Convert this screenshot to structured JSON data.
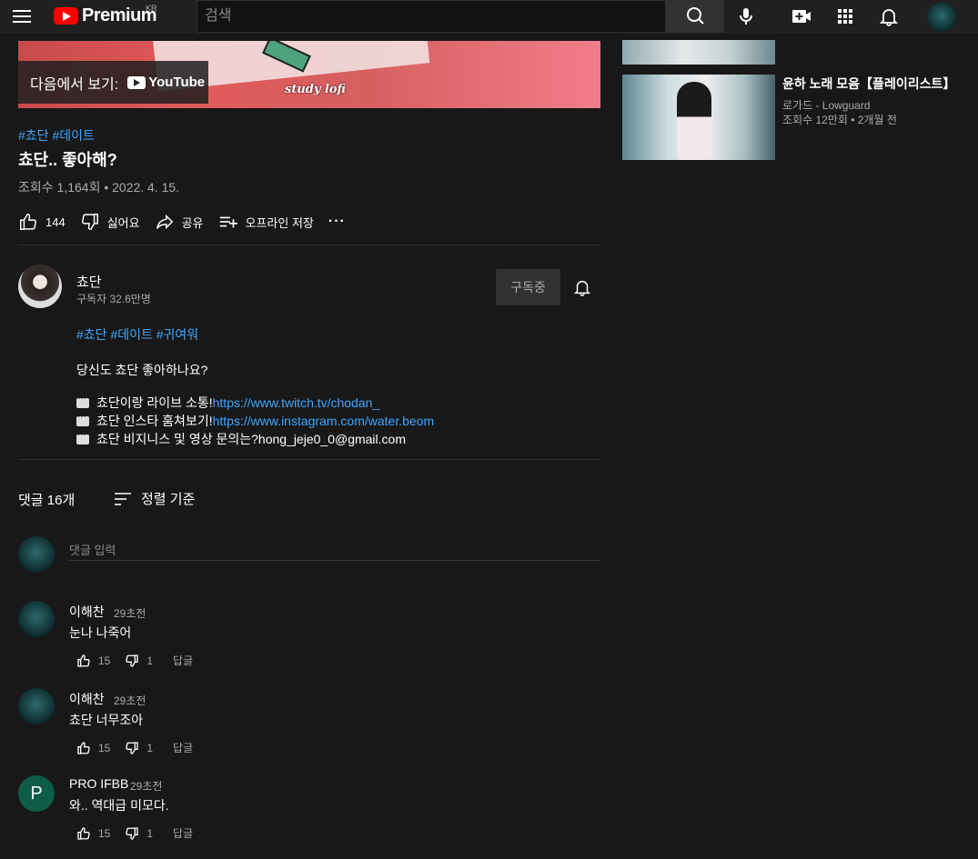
{
  "header": {
    "logo_text": "Premium",
    "region": "KR",
    "search_placeholder": "검색"
  },
  "player": {
    "watch_on_label": "다음에서 보기:",
    "watch_on_brand": "YouTube",
    "overlay_text": "study lofi"
  },
  "video": {
    "hashtags": [
      "#쵸단",
      "#데이트"
    ],
    "title": "쵸단.. 좋아해?",
    "meta": "조회수 1,164회 • 2022. 4. 15.",
    "like_count": "144",
    "dislike_label": "싫어요",
    "share_label": "공유",
    "save_label": "오프라인 저장",
    "more_label": "···"
  },
  "channel": {
    "name": "쵸단",
    "subscribers": "구독자 32.6만명",
    "subscribe_label": "구독중"
  },
  "description": {
    "hashtags": [
      "#쵸단",
      "#데이트",
      "#귀여워"
    ],
    "intro": "당신도 쵸단 좋아하나요?",
    "lines": [
      {
        "text": "쵸단이랑 라이브 소통! ",
        "link": "https://www.twitch.tv/chodan_"
      },
      {
        "text": "쵸단 인스타 훔쳐보기! ",
        "link": "https://www.instagram.com/water.beom"
      },
      {
        "text": "쵸단 비지니스 및 영상 문의는? ",
        "link": "hong_jeje0_0@gmail.com"
      }
    ]
  },
  "comments_section": {
    "count_label": "댓글 16개",
    "sort_label": "정렬 기준",
    "input_placeholder": "댓글 입력",
    "reply_label": "답글",
    "items": [
      {
        "author": "이해찬",
        "time": "29초전",
        "text": "눈나 나죽어",
        "likes": "15",
        "dislikes": "1"
      },
      {
        "author": "이해찬",
        "time": "29초전",
        "text": "쵸단 너무조아",
        "likes": "15",
        "dislikes": "1"
      },
      {
        "author": "PRO IFBB",
        "time": "29초전",
        "text": "와.. 역대급 미모다.",
        "likes": "15",
        "dislikes": "1",
        "avatar_letter": "P"
      }
    ]
  },
  "sidebar": {
    "item_title": "윤하 노래 모음【플레이리스트】",
    "item_channel": "로가드 - Lowguard",
    "item_meta": "조회수 12만회 • 2개월 전"
  }
}
